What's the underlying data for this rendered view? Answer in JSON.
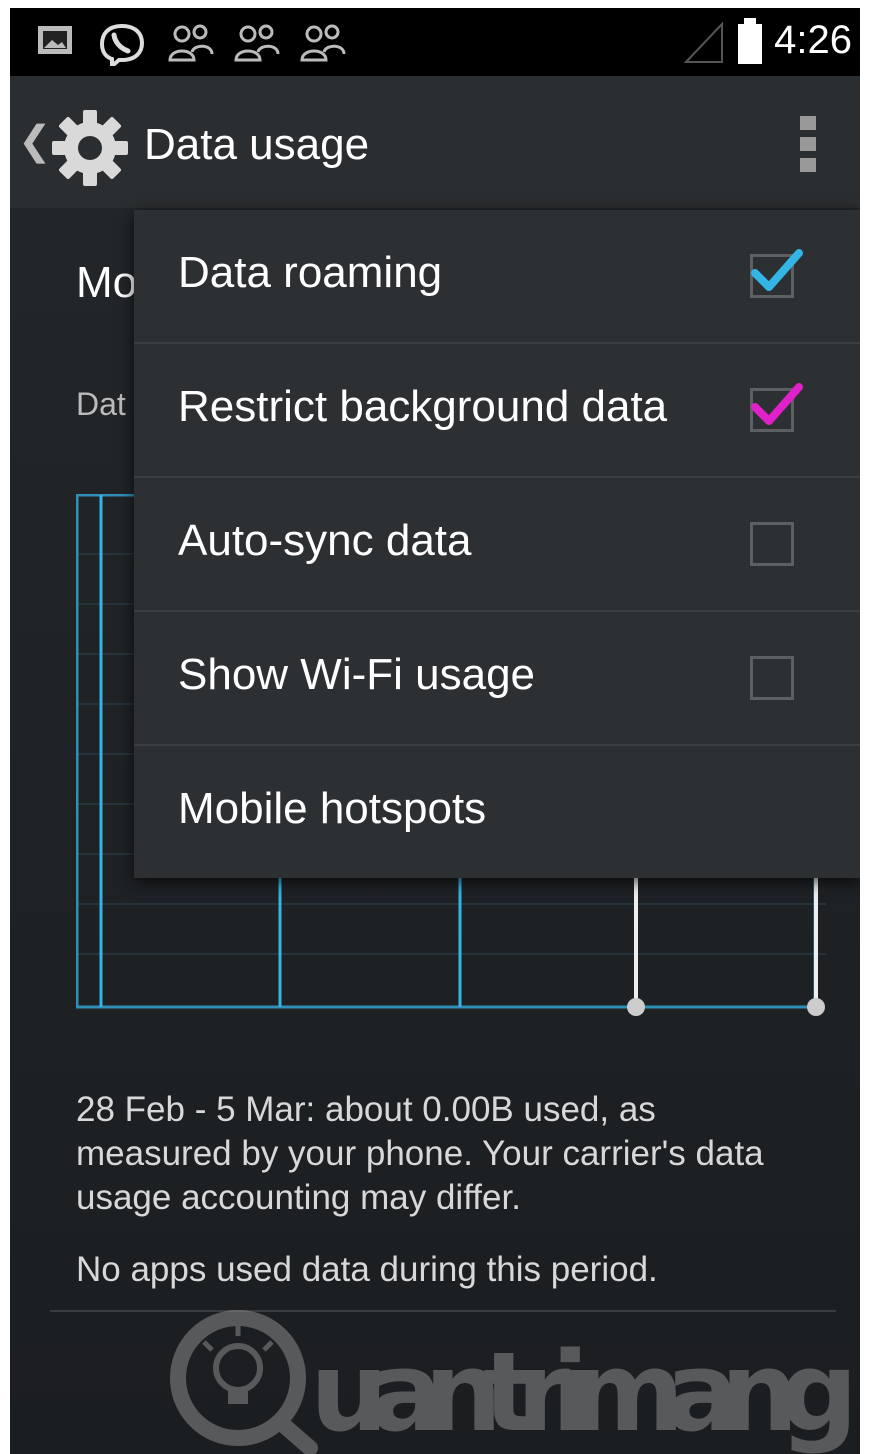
{
  "status_bar": {
    "time": "4:26",
    "icons": [
      "gallery-icon",
      "viber-icon",
      "contacts-icon",
      "contacts-icon",
      "contacts-icon",
      "signal-icon",
      "battery-icon"
    ]
  },
  "action_bar": {
    "title": "Data usage",
    "icons": [
      "back-chevron-icon",
      "settings-gear-icon",
      "overflow-menu-icon"
    ]
  },
  "background": {
    "heading_fragment": "Mo",
    "subheading_fragment": "Dat",
    "summary": "28 Feb - 5 Mar: about 0.00B used, as measured by your phone. Your carrier's data usage accounting may differ.",
    "no_apps": "No apps used data during this period."
  },
  "menu": {
    "items": [
      {
        "label": "Data roaming",
        "checkbox": true,
        "checked": true,
        "check_color": "#33b5e5"
      },
      {
        "label": "Restrict background data",
        "checkbox": true,
        "checked": true,
        "check_color": "#e020c8"
      },
      {
        "label": "Auto-sync data",
        "checkbox": true,
        "checked": false
      },
      {
        "label": "Show Wi-Fi usage",
        "checkbox": true,
        "checked": false
      },
      {
        "label": "Mobile hotspots",
        "checkbox": false
      }
    ]
  },
  "watermark": {
    "text": "Quantrimang",
    "icon": "lightbulb-icon"
  },
  "colors": {
    "accent": "#33b5e5",
    "background": "#1c1f22",
    "menu": "#2d3033"
  }
}
